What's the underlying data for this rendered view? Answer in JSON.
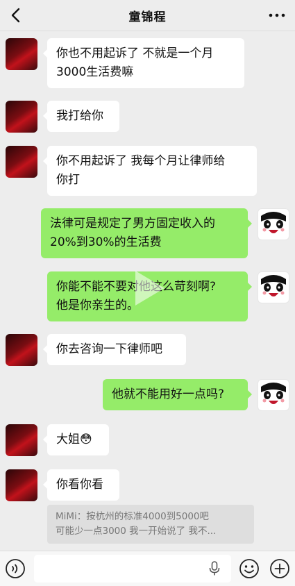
{
  "header": {
    "title": "童锦程",
    "back_icon": "chevron-left-icon",
    "more_icon": "more-dots-icon"
  },
  "messages": [
    {
      "side": "left",
      "text": "你也不用起诉了 不就是一个月\n3000生活费嘛"
    },
    {
      "side": "left",
      "text": "我打给你"
    },
    {
      "side": "left",
      "text": "你不用起诉了 我每个月让律师给\n你打"
    },
    {
      "side": "right",
      "text": "法律可是规定了男方固定收入的\n20%到30%的生活费"
    },
    {
      "side": "right",
      "text": "你能不能不要对他这么苛刻啊?\n他是你亲生的。"
    },
    {
      "side": "left",
      "text": "你去咨询一下律师吧"
    },
    {
      "side": "right",
      "text": "他就不能用好一点吗?"
    },
    {
      "side": "left",
      "text": "大姐",
      "emoji": "😳"
    },
    {
      "side": "left",
      "text": "你看你看"
    }
  ],
  "quote": {
    "line1": "MiMi：按杭州的标准4000到5000吧",
    "line2": "可能少一点3000 我一开始说了 我不..."
  },
  "bottom_bar": {
    "voice_icon": "voice-icon",
    "mic_icon": "mic-icon",
    "emoji_icon": "emoji-icon",
    "plus_icon": "plus-icon",
    "input_value": ""
  },
  "colors": {
    "own_bubble": "#95ec69",
    "other_bubble": "#ffffff",
    "background": "#ededed"
  }
}
